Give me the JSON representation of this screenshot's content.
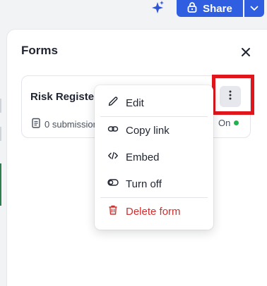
{
  "toolbar": {
    "share_label": "Share",
    "icons": [
      "sparkle-icon",
      "lock-icon",
      "chevron-down-icon"
    ],
    "accent": "#2f5fe0"
  },
  "panel": {
    "title": "Forms",
    "close_icon": "close-icon"
  },
  "form_card": {
    "title": "Risk Register",
    "submissions": "0 submissions",
    "status_label": "On",
    "status_color": "#22b14c"
  },
  "menu": {
    "items": [
      {
        "label": "Edit",
        "icon": "pencil-icon"
      },
      {
        "label": "Copy link",
        "icon": "link-icon"
      },
      {
        "label": "Embed",
        "icon": "code-icon"
      },
      {
        "label": "Turn off",
        "icon": "toggle-icon"
      },
      {
        "label": "Delete form",
        "icon": "trash-icon",
        "danger": true
      }
    ],
    "danger_color": "#d0302f"
  },
  "highlight_color": "#e0161c"
}
